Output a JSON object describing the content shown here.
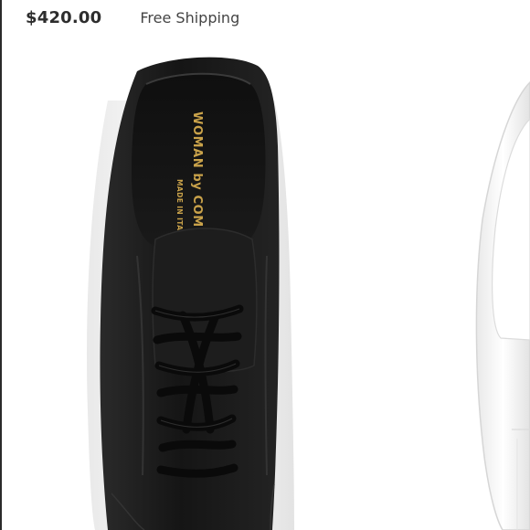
{
  "listing": {
    "price": "$420.00",
    "shipping": "Free Shipping"
  },
  "product_image": {
    "insole_brand_line1": "WOMAN by COMMON",
    "insole_brand_line2": "MADE IN ITALY",
    "icon": "sneaker-photo"
  },
  "colors": {
    "shoe_leather": "#1c1c1c",
    "sole": "#f2f2f2",
    "insole_print": "#c9a24a",
    "price_text": "#2d2d2d"
  }
}
